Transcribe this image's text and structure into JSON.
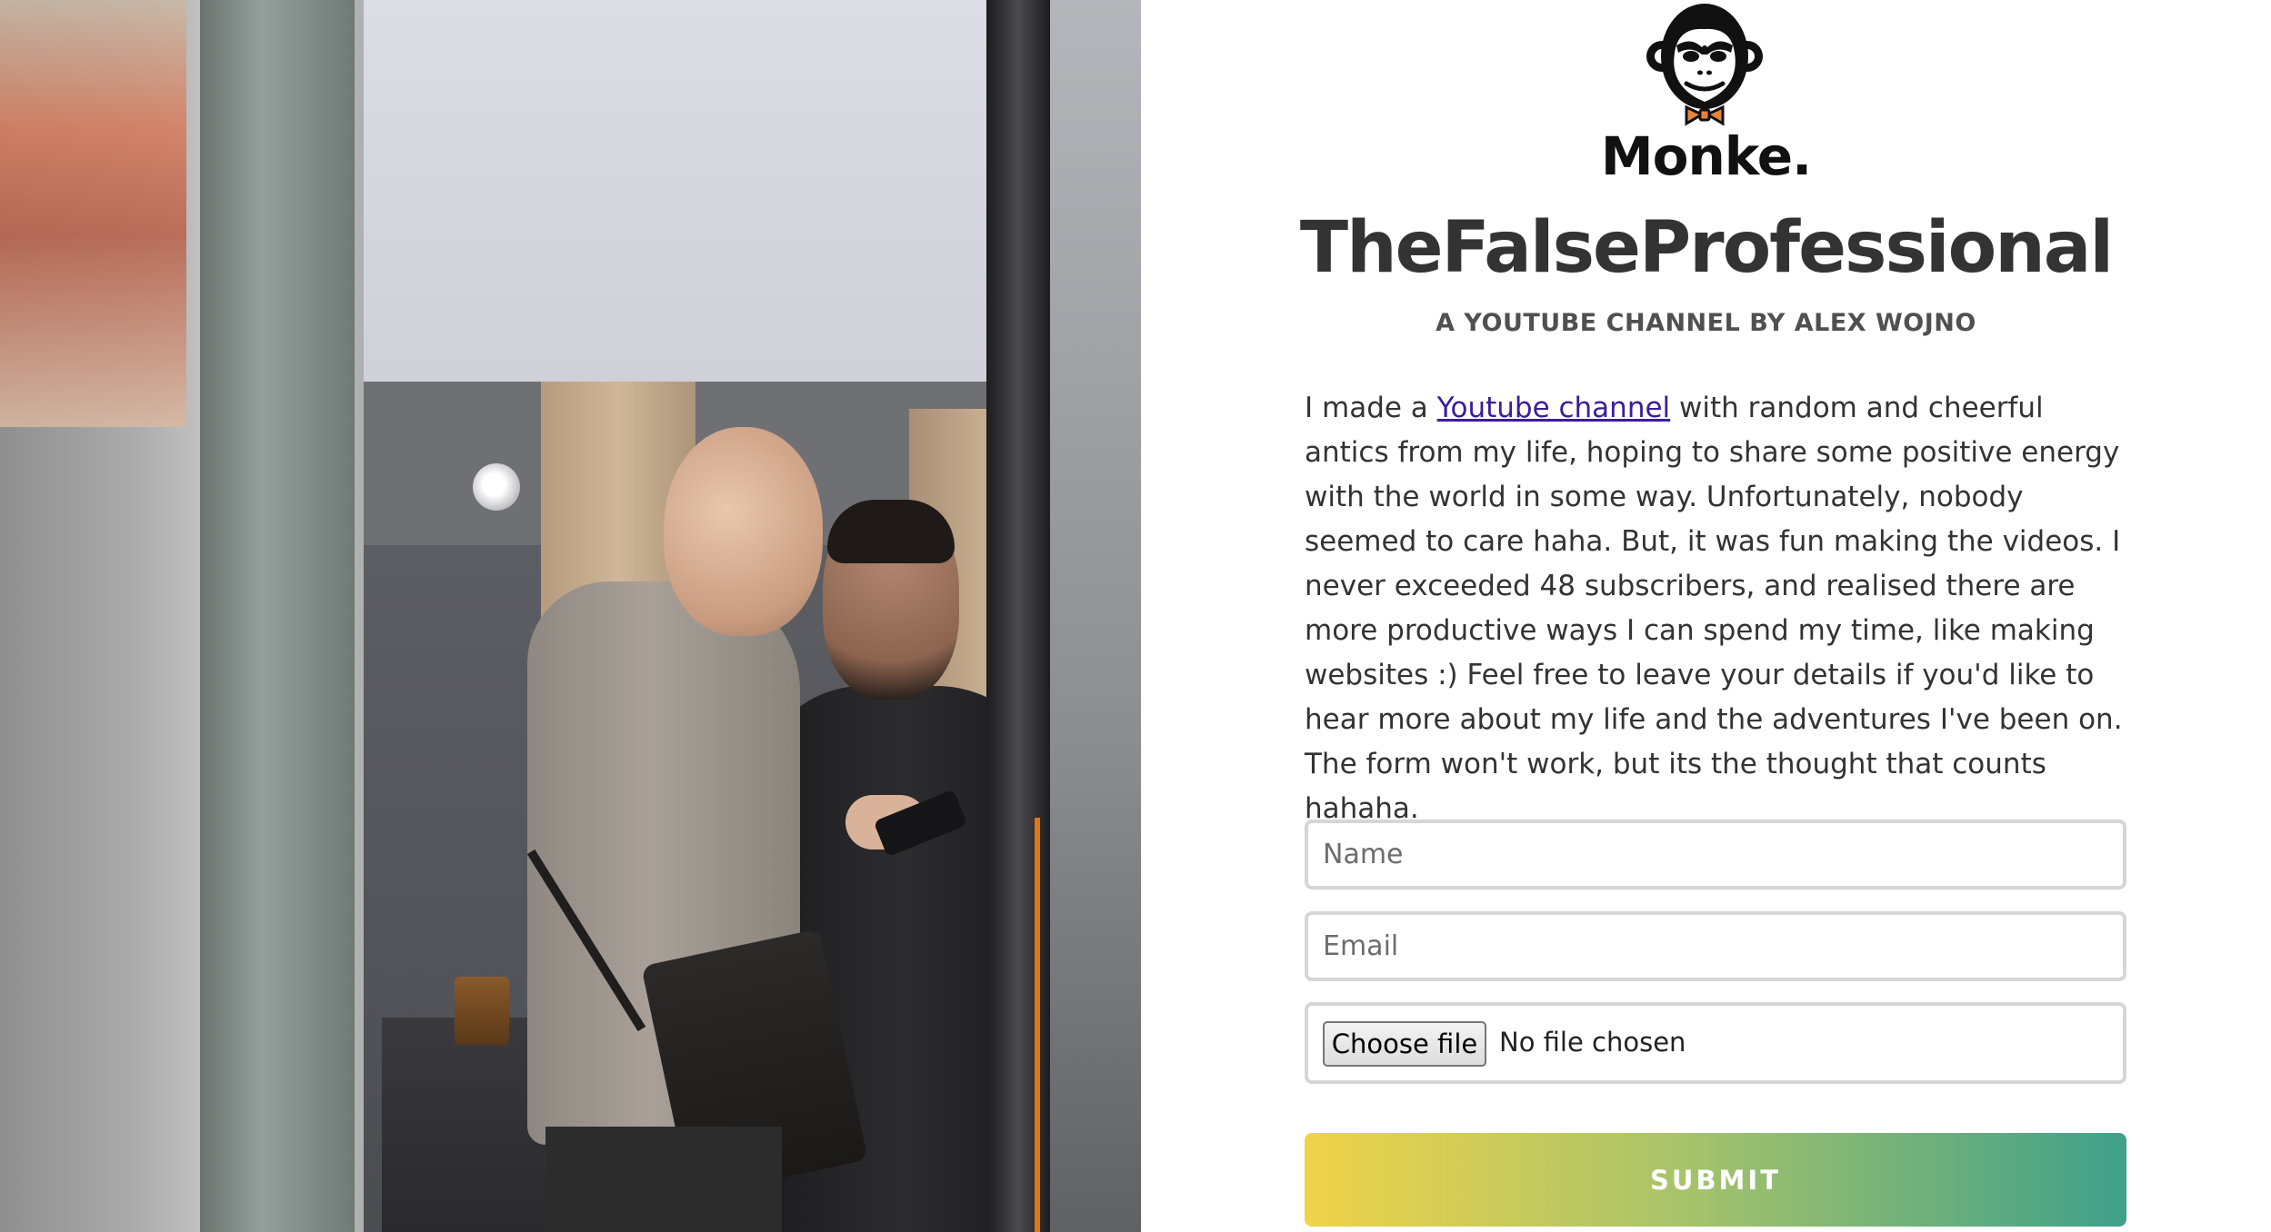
{
  "brand": {
    "logo_icon": "monkey-head-bowtie-icon",
    "logo_text": "Monke."
  },
  "header": {
    "title": "TheFalseProfessional",
    "subtitle": "A YOUTUBE CHANNEL BY ALEX WOJNO"
  },
  "intro": {
    "before_link": "I made a ",
    "link_text": "Youtube channel",
    "after_link": " with random and cheerful antics from my life, hoping to share some positive energy with the world in some way. Unfortunately, nobody seemed to care haha. But, it was fun making the videos. I never exceeded 48 subscribers, and realised there are more productive ways I can spend my time, like making websites :) Feel free to leave your details if you'd like to hear more about my life and the adventures I've been on. The form won't work, but its the thought that counts hahaha."
  },
  "form": {
    "name_placeholder": "Name",
    "email_placeholder": "Email",
    "file_button_label": "Choose file",
    "file_status": "No file chosen",
    "submit_label": "SUBMIT"
  },
  "colors": {
    "title": "#333333",
    "link": "#3a1d9a",
    "submit_gradient_start": "#f0d348",
    "submit_gradient_end": "#3fa08a",
    "logo_bowtie": "#e8843a"
  }
}
